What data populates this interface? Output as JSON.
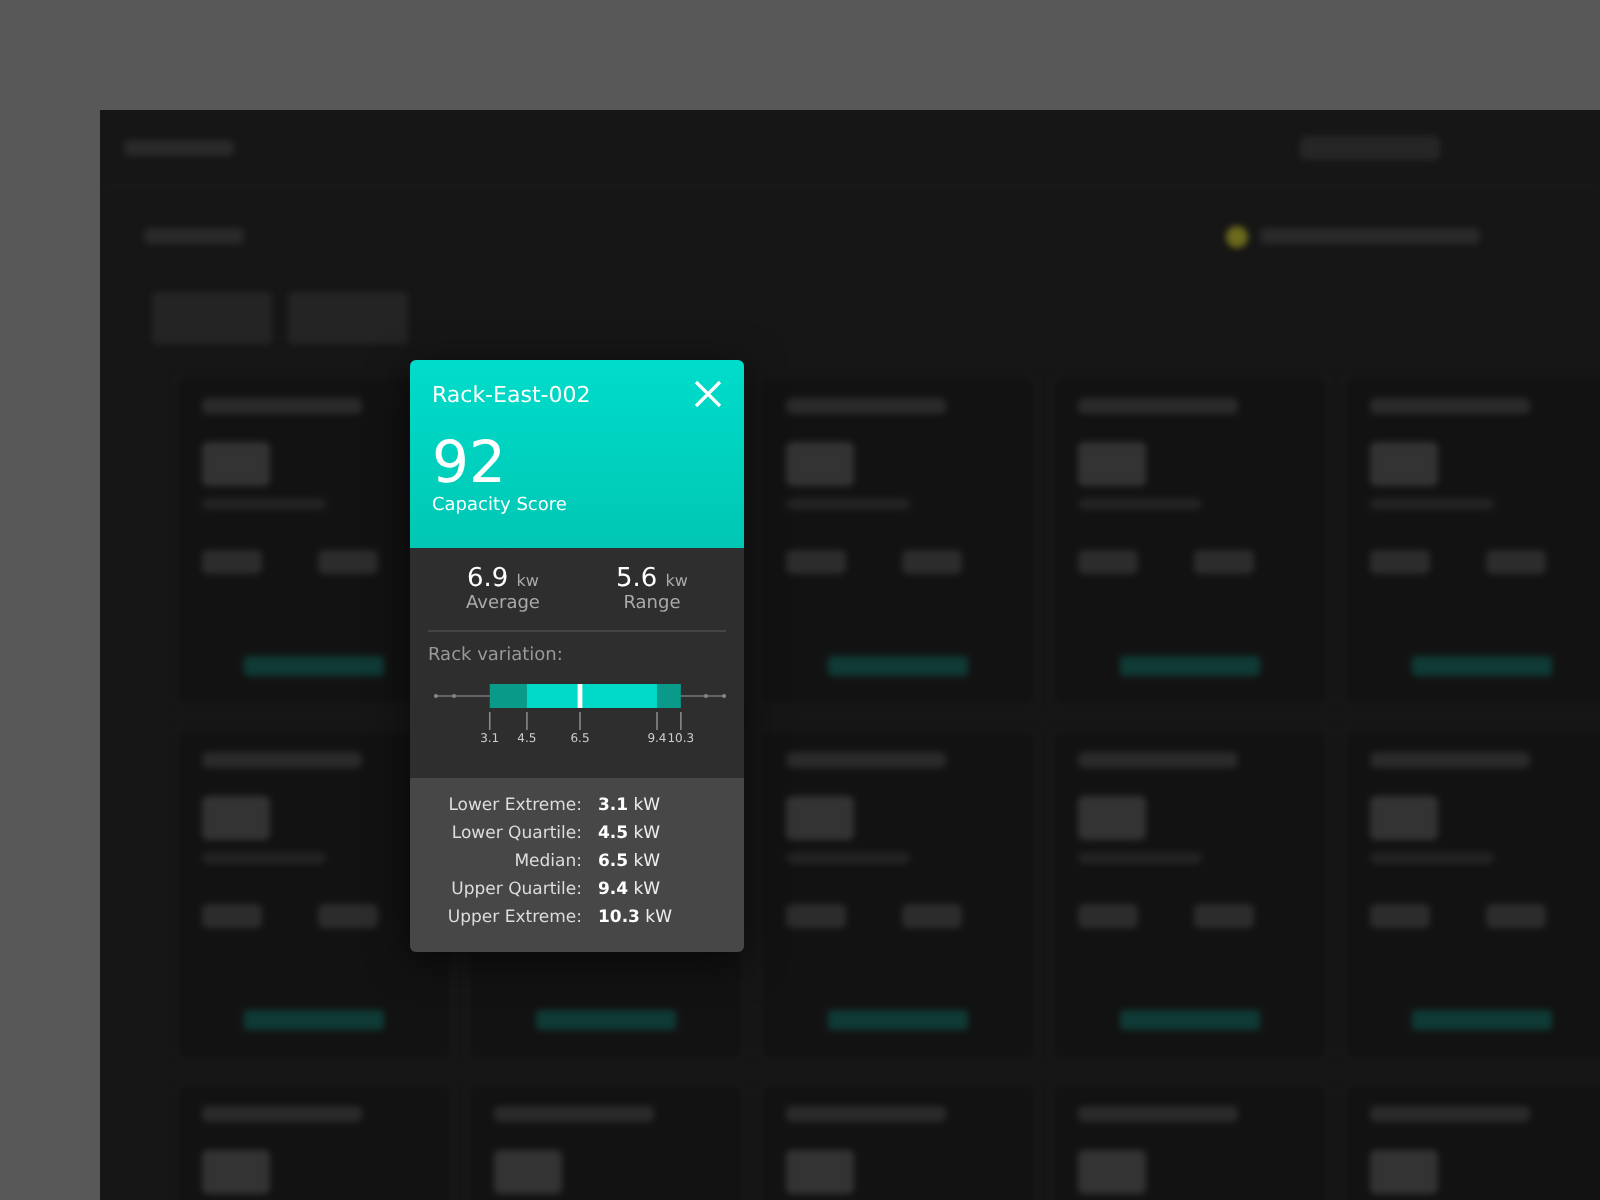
{
  "popup": {
    "title": "Rack-East-002",
    "score": "92",
    "score_label": "Capacity Score",
    "stats": [
      {
        "value": "6.9",
        "unit": "kw",
        "label": "Average"
      },
      {
        "value": "5.6",
        "unit": "kw",
        "label": "Range"
      }
    ],
    "variation_label": "Rack variation:",
    "boxplot_ticks": [
      "3.1",
      "4.5",
      "6.5",
      "9.4",
      "10.3"
    ],
    "details": [
      {
        "label": "Lower Extreme:",
        "value": "3.1",
        "unit": "kW"
      },
      {
        "label": "Lower Quartile:",
        "value": "4.5",
        "unit": "kW"
      },
      {
        "label": "Median:",
        "value": "6.5",
        "unit": "kW"
      },
      {
        "label": "Upper Quartile:",
        "value": "9.4",
        "unit": "kW"
      },
      {
        "label": "Upper Extreme:",
        "value": "10.3",
        "unit": "kW"
      }
    ]
  }
}
